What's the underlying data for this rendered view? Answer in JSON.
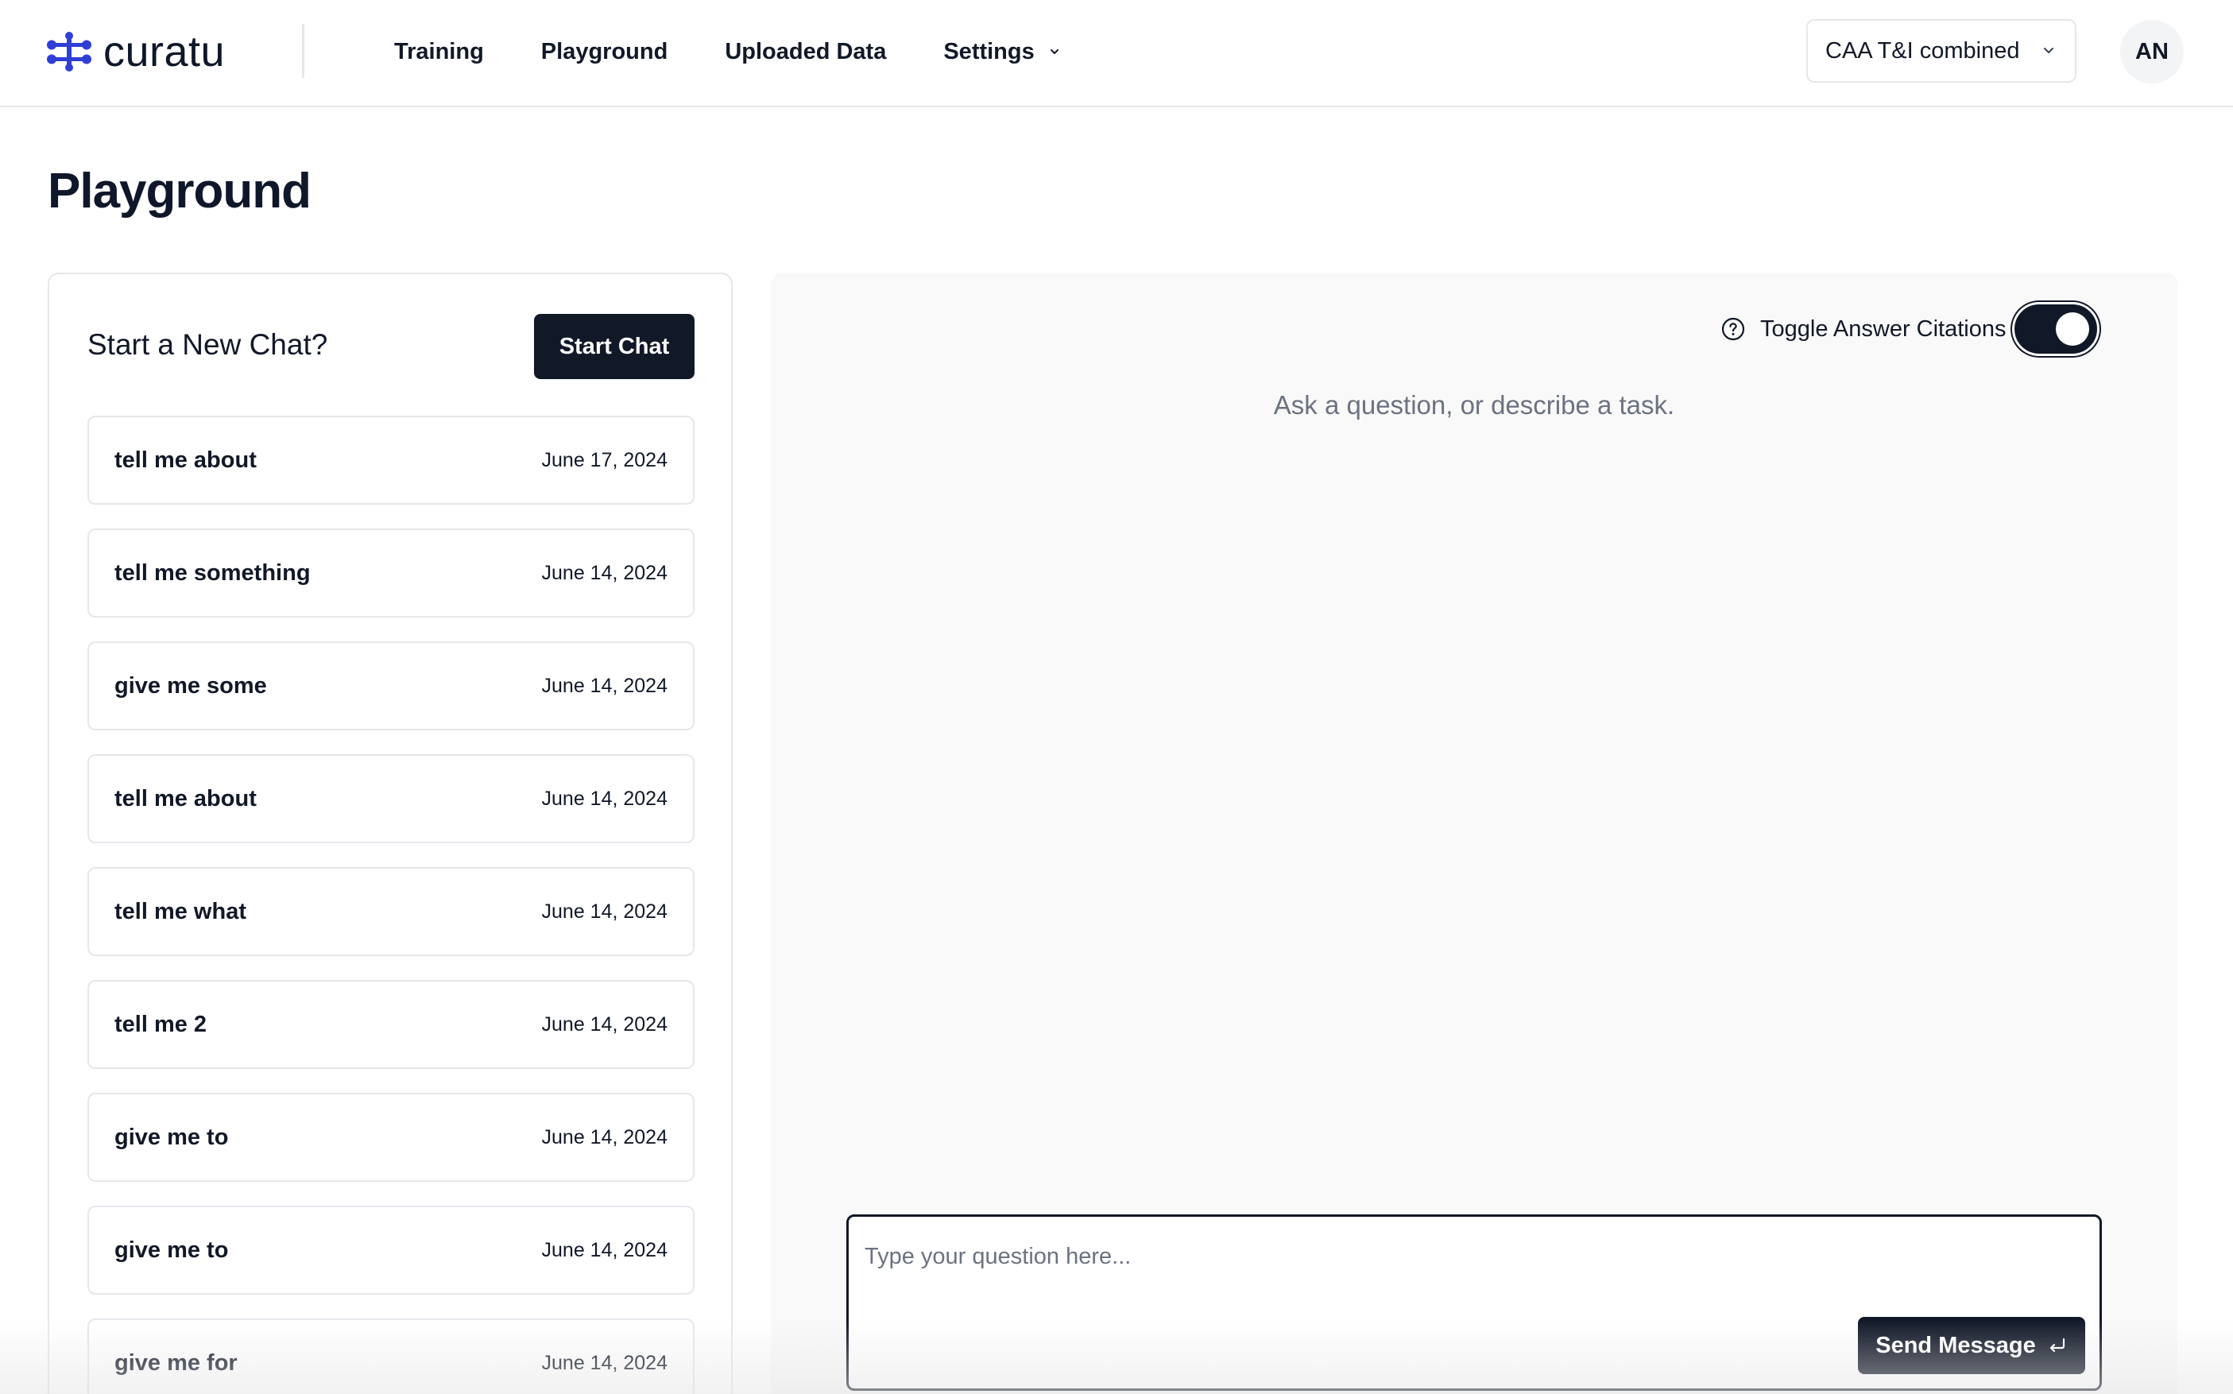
{
  "brand": {
    "name": "curatu",
    "icon": "curatu-logo-icon"
  },
  "nav": {
    "items": [
      {
        "label": "Training"
      },
      {
        "label": "Playground"
      },
      {
        "label": "Uploaded Data"
      },
      {
        "label": "Settings",
        "has_dropdown": true
      }
    ]
  },
  "workspace_select": {
    "value": "CAA T&I combined"
  },
  "user": {
    "initials": "AN"
  },
  "page": {
    "title": "Playground"
  },
  "chat_panel": {
    "heading": "Start a New Chat?",
    "start_button": "Start Chat",
    "chats": [
      {
        "title": "tell me about",
        "date": "June 17, 2024"
      },
      {
        "title": "tell me something",
        "date": "June 14, 2024"
      },
      {
        "title": "give me some",
        "date": "June 14, 2024"
      },
      {
        "title": "tell me about",
        "date": "June 14, 2024"
      },
      {
        "title": "tell me what",
        "date": "June 14, 2024"
      },
      {
        "title": "tell me 2",
        "date": "June 14, 2024"
      },
      {
        "title": "give me to",
        "date": "June 14, 2024"
      },
      {
        "title": "give me to",
        "date": "June 14, 2024"
      },
      {
        "title": "give me for",
        "date": "June 14, 2024"
      }
    ]
  },
  "main": {
    "citations_toggle": {
      "label": "Toggle Answer Citations",
      "on": true
    },
    "empty_prompt": "Ask a question, or describe a task.",
    "composer": {
      "placeholder": "Type your question here...",
      "value": ""
    },
    "send_button": "Send Message"
  },
  "colors": {
    "primary": "#111827",
    "border": "#e5e7eb",
    "panel_bg": "#f9f9f9",
    "muted_text": "#6b7280"
  }
}
